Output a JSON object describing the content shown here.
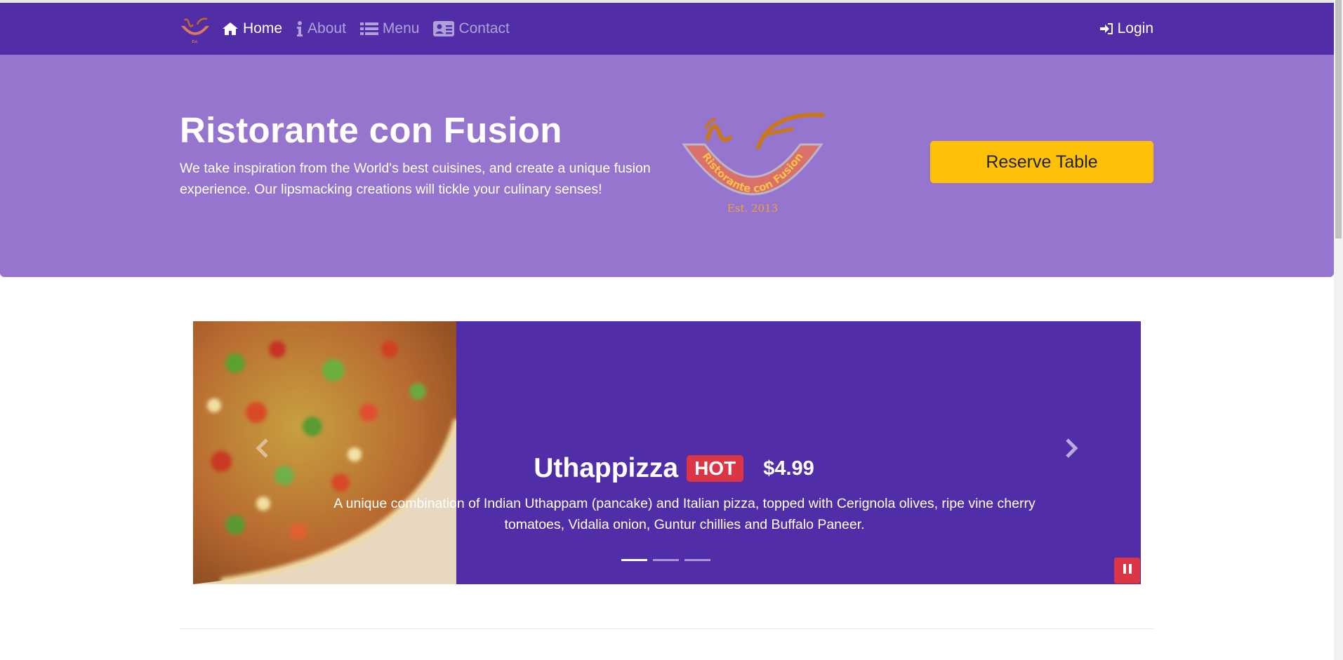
{
  "nav": {
    "logo_name": "restaurant-logo",
    "items": [
      {
        "label": "Home",
        "icon": "home-icon",
        "active": true
      },
      {
        "label": "About",
        "icon": "info-icon",
        "active": false
      },
      {
        "label": "Menu",
        "icon": "list-icon",
        "active": false
      },
      {
        "label": "Contact",
        "icon": "address-card-icon",
        "active": false
      }
    ],
    "login_label": "Login",
    "login_icon": "sign-in-icon"
  },
  "hero": {
    "title": "Ristorante con Fusion",
    "text": "We take inspiration from the World's best cuisines, and create a unique fusion experience. Our lipsmacking creations will tickle your culinary senses!",
    "logo_text": "Ristorante con Fusion",
    "logo_est": "Est. 2013",
    "reserve_label": "Reserve Table"
  },
  "carousel": {
    "dish_name": "Uthappizza",
    "badge": "HOT",
    "price": "$4.99",
    "description": "A unique combination of Indian Uthappam (pancake) and Italian pizza, topped with Cerignola olives, ripe vine cherry tomatoes, Vidalia onion, Guntur chillies and Buffalo Paneer.",
    "slides": 3,
    "active_slide": 1
  },
  "colors": {
    "primary_dark": "#512da8",
    "primary_light": "#9575cd",
    "warning": "#ffc107",
    "danger": "#dc3545"
  }
}
